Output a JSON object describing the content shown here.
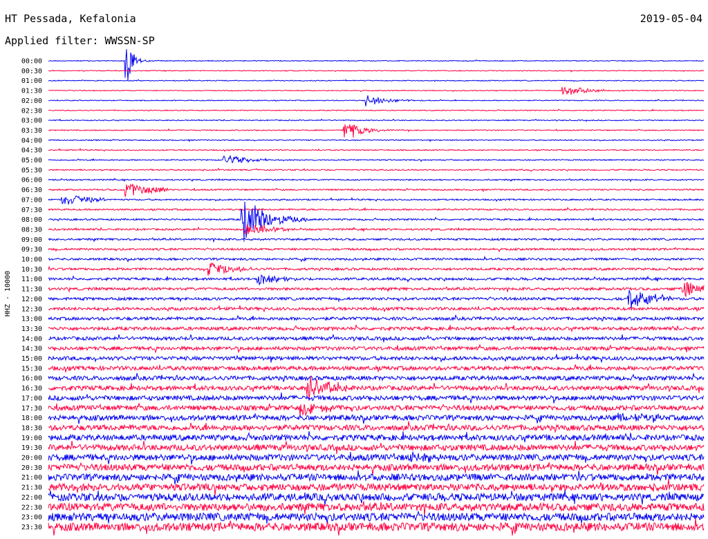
{
  "header": {
    "title": "HT Pessada, Kefalonia",
    "filter": "Applied filter: WWSSN-SP",
    "date": "2019-05-04"
  },
  "chart_data": {
    "type": "helicorder",
    "ylabel": "HHZ - 10000",
    "line_labels": [
      "00:00",
      "00:30",
      "01:00",
      "01:30",
      "02:00",
      "02:30",
      "03:00",
      "03:30",
      "04:00",
      "04:30",
      "05:00",
      "05:30",
      "06:00",
      "06:30",
      "07:00",
      "07:30",
      "08:00",
      "08:30",
      "09:00",
      "09:30",
      "10:00",
      "10:30",
      "11:00",
      "11:30",
      "12:00",
      "12:30",
      "13:00",
      "13:30",
      "14:00",
      "14:30",
      "15:00",
      "15:30",
      "16:00",
      "16:30",
      "17:00",
      "17:30",
      "18:00",
      "18:30",
      "19:00",
      "19:30",
      "20:00",
      "20:30",
      "21:00",
      "21:30",
      "22:00",
      "22:30",
      "23:00",
      "23:30"
    ],
    "colors": [
      "#0000ee",
      "#ff0040"
    ],
    "line_minutes": 30,
    "events": [
      {
        "line": 0,
        "minute": 3.5,
        "amp": 60,
        "decay": 0.25,
        "dur": 28
      },
      {
        "line": 7,
        "minute": 13.5,
        "amp": 16,
        "decay": 0.8,
        "dur": 4
      },
      {
        "line": 4,
        "minute": 14.5,
        "amp": 10,
        "decay": 0.8,
        "dur": 3
      },
      {
        "line": 16,
        "minute": 8.8,
        "amp": 40,
        "decay": 1.0,
        "dur": 3
      },
      {
        "line": 22,
        "minute": 9.5,
        "amp": 9,
        "decay": 1.0,
        "dur": 2
      },
      {
        "line": 24,
        "minute": 26.5,
        "amp": 18,
        "decay": 1.2,
        "dur": 2
      },
      {
        "line": 23,
        "minute": 29.0,
        "amp": 14,
        "decay": 1.0,
        "dur": 2
      },
      {
        "line": 35,
        "minute": 11.5,
        "amp": 12,
        "decay": 1.0,
        "dur": 2
      },
      {
        "line": 33,
        "minute": 11.8,
        "amp": 18,
        "decay": 1.2,
        "dur": 2
      },
      {
        "line": 17,
        "minute": 9.0,
        "amp": 8,
        "decay": 1.2,
        "dur": 2
      },
      {
        "line": 13,
        "minute": 3.5,
        "amp": 12,
        "decay": 1.2,
        "dur": 2
      },
      {
        "line": 3,
        "minute": 23.5,
        "amp": 8,
        "decay": 1.2,
        "dur": 2
      },
      {
        "line": 10,
        "minute": 8.0,
        "amp": 8,
        "decay": 1.2,
        "dur": 2
      },
      {
        "line": 14,
        "minute": 0.6,
        "amp": 10,
        "decay": 1.2,
        "dur": 2
      },
      {
        "line": 36,
        "minute": 26.0,
        "amp": 8,
        "decay": 1.2,
        "dur": 2
      },
      {
        "line": 21,
        "minute": 7.3,
        "amp": 10,
        "decay": 1.2,
        "dur": 2
      },
      {
        "line": 40,
        "minute": 16.5,
        "amp": 8,
        "decay": 1.2,
        "dur": 2
      }
    ]
  }
}
